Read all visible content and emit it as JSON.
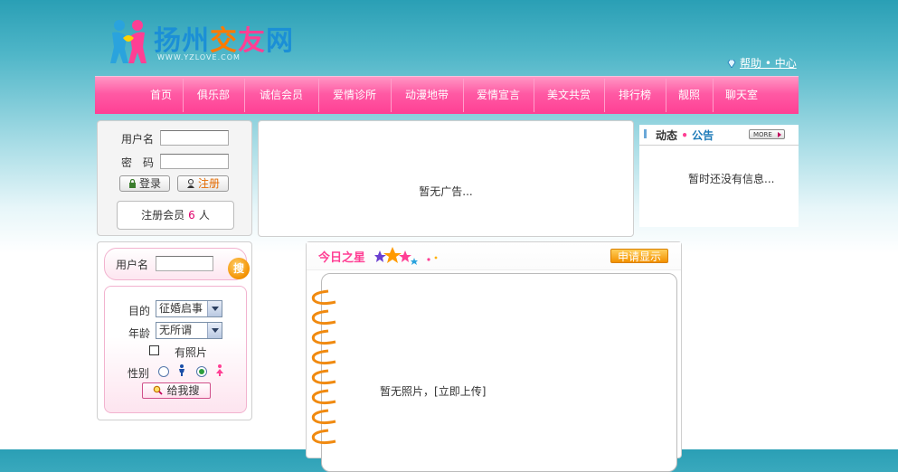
{
  "header": {
    "logo_text": "扬州交友网",
    "logo_url": "WWW.YZLOVE.COM",
    "help_link": "帮助 • 中心"
  },
  "nav": {
    "items": [
      "首页",
      "俱乐部",
      "诚信会员",
      "爱情诊所",
      "动漫地带",
      "爱情宣言",
      "美文共赏",
      "排行榜",
      "靓照",
      "聊天室"
    ]
  },
  "login": {
    "username_label": "用户名",
    "password_label": "密　码",
    "username_value": "",
    "password_value": "",
    "login_button": "登录",
    "register_button": "注册",
    "member_count_prefix": "注册会员",
    "member_count": "6",
    "member_count_suffix": "人"
  },
  "ad": {
    "text": "暂无广告..."
  },
  "news": {
    "title_part1": "动态",
    "title_sep": "•",
    "title_part2": "公告",
    "more_label": "MORE",
    "empty_text": "暂时还没有信息..."
  },
  "search": {
    "username_label": "用户名",
    "username_value": "",
    "go_button": "搜",
    "purpose_label": "目的",
    "purpose_selected": "征婚启事",
    "age_label": "年龄",
    "age_selected": "无所谓",
    "has_photo_label": "有照片",
    "has_photo_checked": false,
    "gender_label": "性别",
    "gender_selected": "female",
    "submit_label": "给我搜"
  },
  "star": {
    "title": "今日之星",
    "apply_button": "申请显示",
    "empty_text": "暂无照片，",
    "upload_link": "[立即上传]"
  },
  "colors": {
    "nav_pink": "#ff5aa4",
    "accent_orange": "#f39100",
    "count_red": "#e0006b"
  }
}
